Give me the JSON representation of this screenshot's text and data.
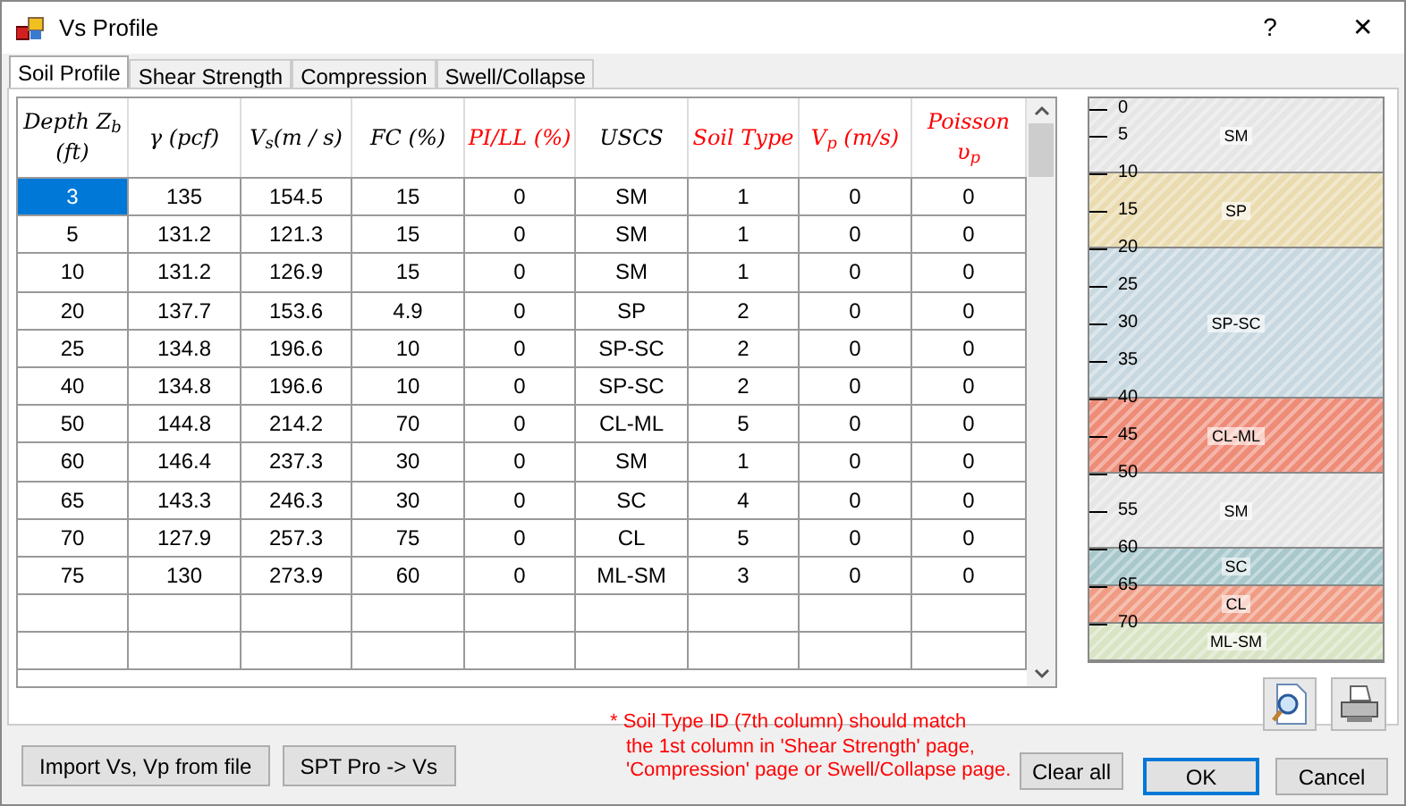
{
  "window": {
    "title": "Vs Profile",
    "help": "?",
    "close": "✕"
  },
  "tabs": [
    {
      "label": "Soil Profile",
      "selected": true
    },
    {
      "label": "Shear Strength",
      "selected": false
    },
    {
      "label": "Compression",
      "selected": false
    },
    {
      "label": "Swell/Collapse",
      "selected": false
    }
  ],
  "table": {
    "columns": [
      {
        "label": "Depth Z$_{b}$ (ft)",
        "color": "#000000"
      },
      {
        "label": "γ (pcf)",
        "color": "#000000"
      },
      {
        "label": "V$_{s}$(m / s)",
        "color": "#000000"
      },
      {
        "label": "FC (%)",
        "color": "#000000"
      },
      {
        "label": "PI/LL (%)",
        "color": "#ff0000"
      },
      {
        "label": "USCS",
        "color": "#000000"
      },
      {
        "label": "Soil Type",
        "color": "#ff0000"
      },
      {
        "label": "V$_{p}$ (m/s)",
        "color": "#ff0000"
      },
      {
        "label": "Poisson υ$_{p}$",
        "color": "#ff0000"
      }
    ],
    "rows": [
      {
        "cells": [
          "3",
          "135",
          "154.5",
          "15",
          "0",
          "SM",
          "1",
          "0",
          "0"
        ],
        "selected": true
      },
      {
        "cells": [
          "5",
          "131.2",
          "121.3",
          "15",
          "0",
          "SM",
          "1",
          "0",
          "0"
        ],
        "selected": false
      },
      {
        "cells": [
          "10",
          "131.2",
          "126.9",
          "15",
          "0",
          "SM",
          "1",
          "0",
          "0"
        ],
        "selected": false
      },
      {
        "cells": [
          "20",
          "137.7",
          "153.6",
          "4.9",
          "0",
          "SP",
          "2",
          "0",
          "0"
        ],
        "selected": false
      },
      {
        "cells": [
          "25",
          "134.8",
          "196.6",
          "10",
          "0",
          "SP-SC",
          "2",
          "0",
          "0"
        ],
        "selected": false
      },
      {
        "cells": [
          "40",
          "134.8",
          "196.6",
          "10",
          "0",
          "SP-SC",
          "2",
          "0",
          "0"
        ],
        "selected": false
      },
      {
        "cells": [
          "50",
          "144.8",
          "214.2",
          "70",
          "0",
          "CL-ML",
          "5",
          "0",
          "0"
        ],
        "selected": false
      },
      {
        "cells": [
          "60",
          "146.4",
          "237.3",
          "30",
          "0",
          "SM",
          "1",
          "0",
          "0"
        ],
        "selected": false
      },
      {
        "cells": [
          "65",
          "143.3",
          "246.3",
          "30",
          "0",
          "SC",
          "4",
          "0",
          "0"
        ],
        "selected": false
      },
      {
        "cells": [
          "70",
          "127.9",
          "257.3",
          "75",
          "0",
          "CL",
          "5",
          "0",
          "0"
        ],
        "selected": false
      },
      {
        "cells": [
          "75",
          "130",
          "273.9",
          "60",
          "0",
          "ML-SM",
          "3",
          "0",
          "0"
        ],
        "selected": false
      }
    ]
  },
  "profile": {
    "ticks": [
      "0",
      "5",
      "10",
      "15",
      "20",
      "25",
      "30",
      "35",
      "40",
      "45",
      "50",
      "55",
      "60",
      "65",
      "70"
    ],
    "layers": [
      {
        "label": "SM",
        "color": "#e6e6e6"
      },
      {
        "label": "SP",
        "color": "#eadcb0"
      },
      {
        "label": "SP-SC",
        "color": "#c8d8e0"
      },
      {
        "label": "CL-ML",
        "color": "#ee8c78"
      },
      {
        "label": "SM",
        "color": "#e6e6e6"
      },
      {
        "label": "SC",
        "color": "#a8c8cc"
      },
      {
        "label": "CL",
        "color": "#f09c84"
      },
      {
        "label": "ML-SM",
        "color": "#d8e4c4"
      }
    ]
  },
  "buttons": {
    "import": "Import Vs, Vp from file",
    "spt": "SPT Pro -> Vs",
    "clear": "Clear all",
    "ok": "OK",
    "cancel": "Cancel"
  },
  "note": [
    "* Soil Type ID (7th column) should match",
    "the 1st column in 'Shear Strength' page,",
    "'Compression' page or Swell/Collapse page."
  ]
}
